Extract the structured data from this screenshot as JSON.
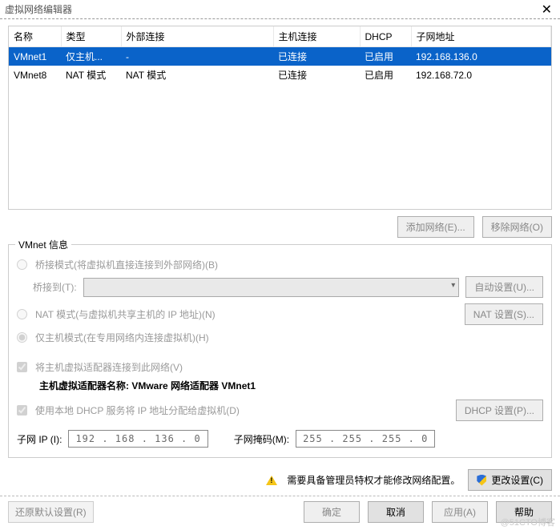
{
  "window": {
    "title": "虚拟网络编辑器"
  },
  "table": {
    "headers": [
      "名称",
      "类型",
      "外部连接",
      "主机连接",
      "DHCP",
      "子网地址"
    ],
    "rows": [
      {
        "name": "VMnet1",
        "type": "仅主机...",
        "ext": "-",
        "host": "已连接",
        "dhcp": "已启用",
        "subnet": "192.168.136.0",
        "selected": true
      },
      {
        "name": "VMnet8",
        "type": "NAT 模式",
        "ext": "NAT 模式",
        "host": "已连接",
        "dhcp": "已启用",
        "subnet": "192.168.72.0",
        "selected": false
      }
    ]
  },
  "buttons": {
    "add_network": "添加网络(E)...",
    "remove_network": "移除网络(O)"
  },
  "vmnet_info": {
    "legend": "VMnet 信息",
    "bridge_radio": "桥接模式(将虚拟机直接连接到外部网络)(B)",
    "bridge_to_label": "桥接到(T):",
    "auto_settings": "自动设置(U)...",
    "nat_radio": "NAT 模式(与虚拟机共享主机的 IP 地址)(N)",
    "nat_settings": "NAT 设置(S)...",
    "hostonly_radio": "仅主机模式(在专用网络内连接虚拟机)(H)",
    "connect_host_check": "将主机虚拟适配器连接到此网络(V)",
    "adapter_label": "主机虚拟适配器名称:",
    "adapter_value": "VMware 网络适配器 VMnet1",
    "dhcp_check": "使用本地 DHCP 服务将 IP 地址分配给虚拟机(D)",
    "dhcp_settings": "DHCP 设置(P)...",
    "subnet_ip_label": "子网 IP (I):",
    "subnet_ip_value": "192 . 168 . 136 .  0",
    "subnet_mask_label": "子网掩码(M):",
    "subnet_mask_value": "255 . 255 . 255 .  0"
  },
  "admin": {
    "warning": "需要具备管理员特权才能修改网络配置。",
    "change_settings": "更改设置(C)"
  },
  "footer": {
    "restore": "还原默认设置(R)",
    "ok": "确定",
    "cancel": "取消",
    "apply": "应用(A)",
    "help": "帮助"
  },
  "watermark": "@51CTO博客"
}
